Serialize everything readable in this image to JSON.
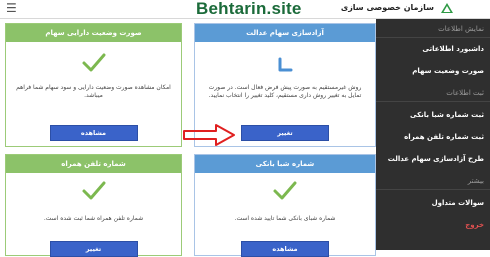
{
  "header": {
    "site_title": "Behtarin.site",
    "brand": "سازمان خصوصی سازی"
  },
  "sidebar": {
    "items": [
      {
        "label": "نمایش اطلاعات",
        "kind": "section"
      },
      {
        "label": "داشبورد اطلاعاتی",
        "kind": "link"
      },
      {
        "label": "صورت وضعیت سهام",
        "kind": "link"
      },
      {
        "label": "ثبت اطلاعات",
        "kind": "section"
      },
      {
        "label": "ثبت شماره شبا بانکی",
        "kind": "link"
      },
      {
        "label": "ثبت شماره تلفن همراه",
        "kind": "link"
      },
      {
        "label": "طرح آزادسازی سهام عدالت",
        "kind": "link"
      },
      {
        "label": "بیشتر",
        "kind": "section"
      },
      {
        "label": "سوالات متداول",
        "kind": "link"
      },
      {
        "label": "خروج",
        "kind": "danger"
      }
    ]
  },
  "cards": {
    "portfolio": {
      "title": "صورت وضعیت دارایی سهام",
      "text": "امکان مشاهده صورت وضعیت دارایی و سود سهام شما فراهم میباشد.",
      "button": "مشاهده"
    },
    "release": {
      "title": "آزادسازی سهام عدالت",
      "text": "روش غیرمستقیم به صورت پیش فرض فعال است. در صورت تمایل به تغییر روش داری مستقیم، کلید تغییر را انتخاب نمایید.",
      "button": "تغییر"
    },
    "phone": {
      "title": "شماره تلفن همراه",
      "text": "شماره تلفن همراه شما ثبت شده است.",
      "button": "تغییر"
    },
    "sheba": {
      "title": "شماره شبا بانکی",
      "text": "شماره شبای بانکی شما تایید شده است.",
      "button": "مشاهده"
    }
  },
  "colors": {
    "accent_green": "#8cc269",
    "accent_blue": "#5b9bd5",
    "button_blue": "#3a63c9",
    "sidebar_bg": "#2f2f2f",
    "arrow_red": "#e02020"
  }
}
